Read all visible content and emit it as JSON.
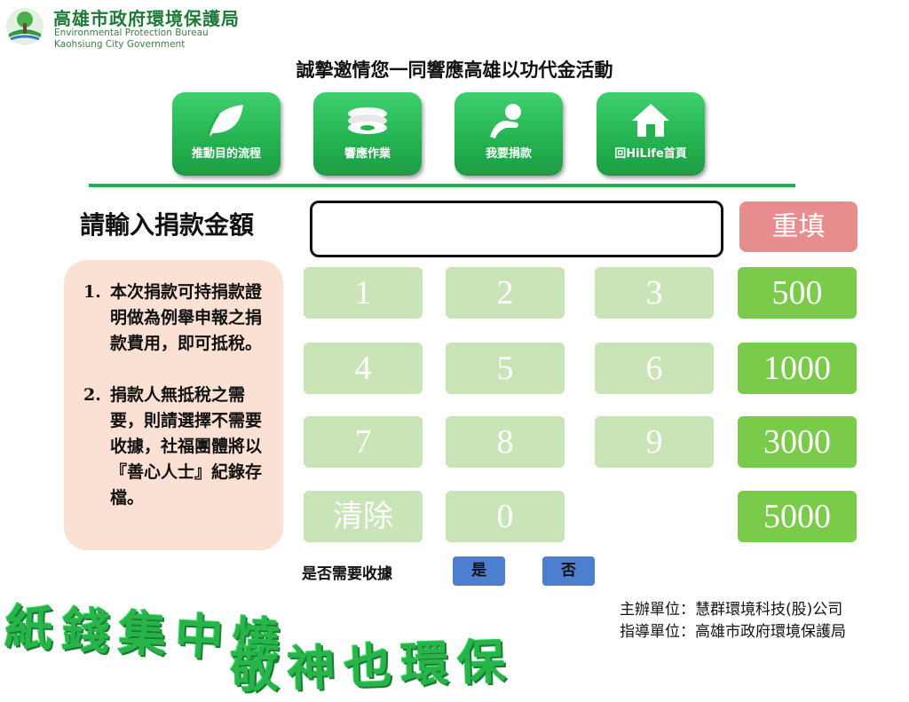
{
  "header": {
    "org_name_cn": "高雄市政府環境保護局",
    "org_name_en_line1": "Environmental Protection Bureau",
    "org_name_en_line2": "Kaohsiung City Government"
  },
  "title": "誠摯邀情您一同響應高雄以功代金活動",
  "nav": [
    {
      "label": "推動目的流程",
      "icon": "leaf-icon"
    },
    {
      "label": "響應作業",
      "icon": "paper-stack-icon"
    },
    {
      "label": "我要捐款",
      "icon": "coin-hand-icon"
    },
    {
      "label": "回HiLife首頁",
      "icon": "home-icon"
    }
  ],
  "amount": {
    "label": "請輸入捐款金額",
    "value": "",
    "reset_label": "重填"
  },
  "notes": [
    {
      "num": "1.",
      "text": "本次捐款可持捐款證明做為例舉申報之捐款費用，即可抵稅。"
    },
    {
      "num": "2.",
      "text": "捐款人無抵稅之需要，則請選擇不需要收據，社福團體將以『善心人士』紀錄存檔。"
    }
  ],
  "keypad": {
    "k1": "1",
    "k2": "2",
    "k3": "3",
    "k4": "4",
    "k5": "5",
    "k6": "6",
    "k7": "7",
    "k8": "8",
    "k9": "9",
    "clear": "清除",
    "k0": "0"
  },
  "amounts": [
    "500",
    "1000",
    "3000",
    "5000"
  ],
  "receipt": {
    "label": "是否需要收據",
    "yes": "是",
    "no": "否"
  },
  "slogan": {
    "line1": "紙錢集中燒",
    "line2": "敬神也環保"
  },
  "credits": {
    "organizer": "主辦單位：慧群環境科技(股)公司",
    "supervisor": "指導單位：高雄市政府環境保護局"
  },
  "colors": {
    "nav_green": "#23b24f",
    "keypad_disabled": "#c9e4b6",
    "amount_green": "#7acb4a",
    "reset_pink": "#e88d8d",
    "note_bg": "#fbe1d4",
    "yes_no_blue": "#4c7fd0"
  }
}
